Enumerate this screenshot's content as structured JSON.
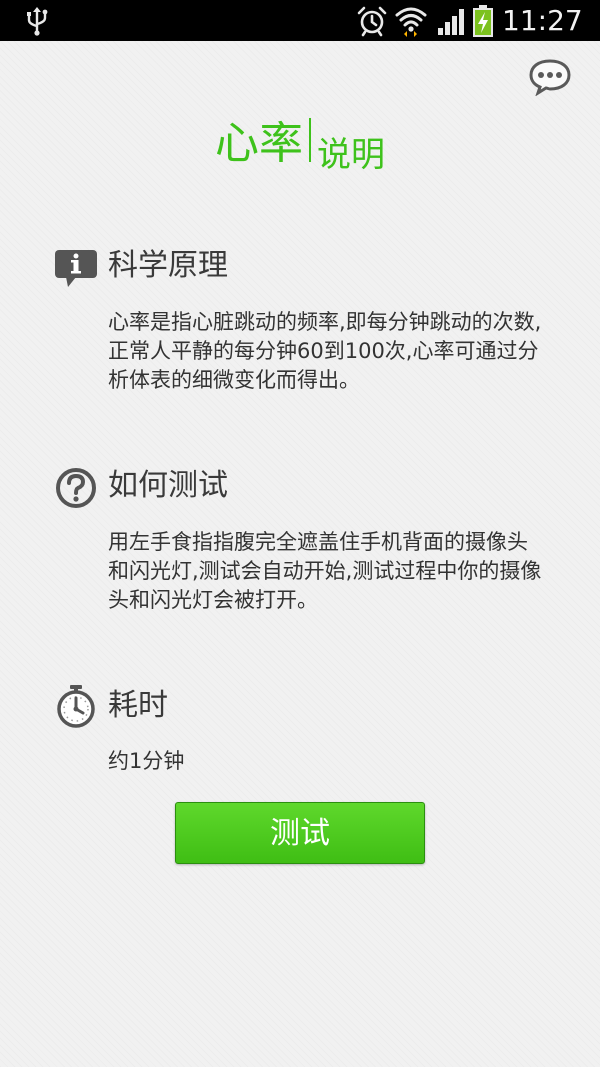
{
  "status_bar": {
    "time": "11:27",
    "icons": [
      "usb-icon",
      "alarm-icon",
      "wifi-icon",
      "signal-icon",
      "battery-charging-icon"
    ]
  },
  "header": {
    "title_main": "心率",
    "title_sub": "说明",
    "menu_icon": "chat-bubble-icon",
    "accent_color": "#3ec21b"
  },
  "sections": [
    {
      "icon": "info-icon",
      "heading": "科学原理",
      "body": "心率是指心脏跳动的频率,即每分钟跳动的次数,正常人平静的每分钟60到100次,心率可通过分析体表的细微变化而得出。"
    },
    {
      "icon": "question-icon",
      "heading": "如何测试",
      "body": "用左手食指指腹完全遮盖住手机背面的摄像头和闪光灯,测试会自动开始,测试过程中你的摄像头和闪光灯会被打开。"
    },
    {
      "icon": "stopwatch-icon",
      "heading": "耗时",
      "body": "约1分钟"
    }
  ],
  "action": {
    "test_label": "测试",
    "button_color": "#4ccd1f"
  }
}
